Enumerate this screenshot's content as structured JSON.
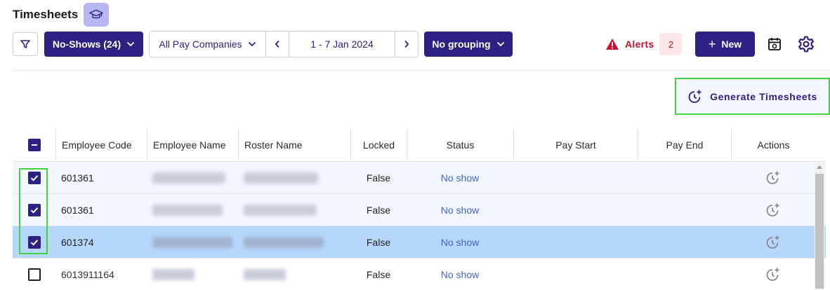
{
  "header": {
    "title": "Timesheets",
    "tutorial_icon": "graduation-cap-icon"
  },
  "toolbar": {
    "filter_icon": "filter-icon",
    "no_shows_label": "No-Shows (24)",
    "pay_company_label": "All Pay Companies",
    "date_range": "1 - 7 Jan 2024",
    "grouping_label": "No grouping",
    "alerts_label": "Alerts",
    "alerts_count": "2",
    "new_label": "New",
    "calendar_icon": "calendar-icon",
    "settings_icon": "gear-icon"
  },
  "generate": {
    "label": "Generate Timesheets"
  },
  "table": {
    "columns": [
      "Employee Code",
      "Employee Name",
      "Roster Name",
      "Locked",
      "Status",
      "Pay Start",
      "Pay End",
      "Actions"
    ],
    "rows": [
      {
        "checked": true,
        "code": "601361",
        "locked": "False",
        "status": "No show",
        "pay_start": "",
        "pay_end": ""
      },
      {
        "checked": true,
        "code": "601361",
        "locked": "False",
        "status": "No show",
        "pay_start": "",
        "pay_end": ""
      },
      {
        "checked": true,
        "code": "601374",
        "locked": "False",
        "status": "No show",
        "pay_start": "",
        "pay_end": ""
      },
      {
        "checked": false,
        "code": "6013911164",
        "locked": "False",
        "status": "No show",
        "pay_start": "",
        "pay_end": ""
      }
    ]
  },
  "colors": {
    "primary": "#2d2183",
    "alert": "#c8102e",
    "highlight": "#3fd43a",
    "selected_row": "#b6d7fb"
  }
}
